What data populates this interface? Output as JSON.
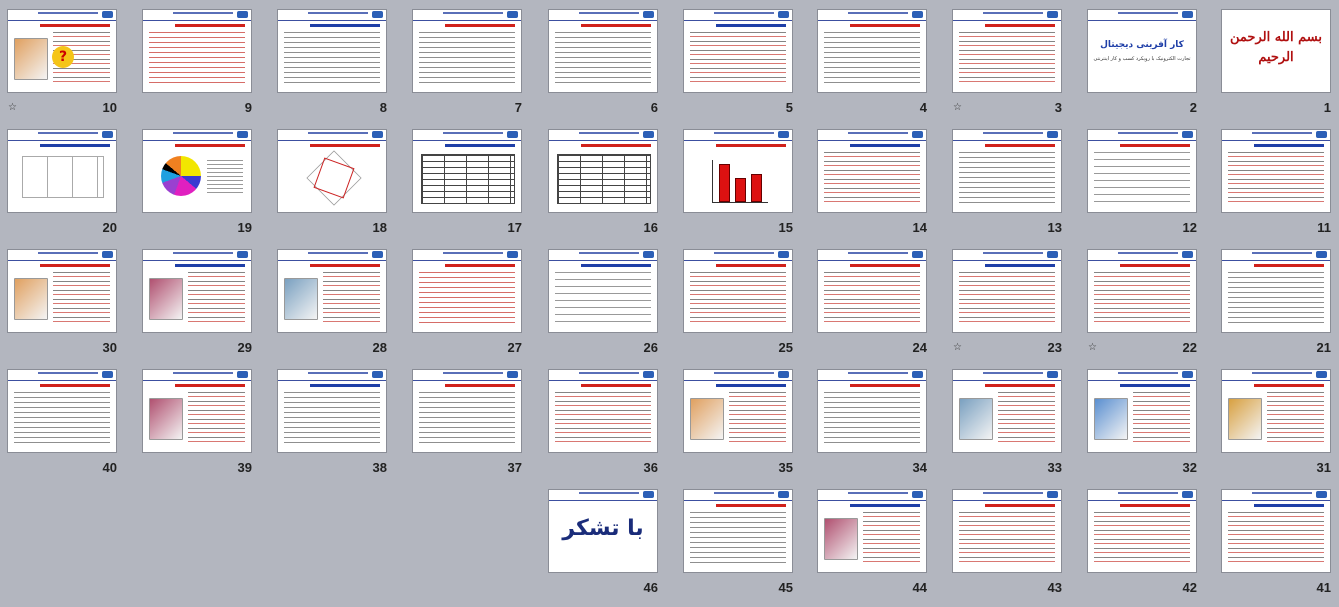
{
  "view": "slide-sorter",
  "slides": [
    {
      "number": "1",
      "variant": "calligraphy",
      "calligraphy": "بسم الله الرحمن الرحیم",
      "star": false
    },
    {
      "number": "2",
      "variant": "cover",
      "cover_title": "کار آفرینی دیجیتال",
      "cover_subtitle": "تجارت الکترونیک با رویکرد کسب و کار اینترنتی",
      "star": false
    },
    {
      "number": "3",
      "variant": "mix",
      "star": true
    },
    {
      "number": "4",
      "variant": "text",
      "star": false
    },
    {
      "number": "5",
      "variant": "mix",
      "star": false
    },
    {
      "number": "6",
      "variant": "text",
      "star": false
    },
    {
      "number": "7",
      "variant": "text",
      "star": false
    },
    {
      "number": "8",
      "variant": "text",
      "star": false
    },
    {
      "number": "9",
      "variant": "red",
      "star": false
    },
    {
      "number": "10",
      "variant": "diagram",
      "star": true
    },
    {
      "number": "11",
      "variant": "mix",
      "star": false
    },
    {
      "number": "12",
      "variant": "sparse",
      "star": false
    },
    {
      "number": "13",
      "variant": "text",
      "star": false
    },
    {
      "number": "14",
      "variant": "mix",
      "star": false
    },
    {
      "number": "15",
      "variant": "barchart",
      "star": false
    },
    {
      "number": "16",
      "variant": "table",
      "star": false
    },
    {
      "number": "17",
      "variant": "table",
      "star": false
    },
    {
      "number": "18",
      "variant": "radar",
      "star": false
    },
    {
      "number": "19",
      "variant": "piechart",
      "star": false
    },
    {
      "number": "20",
      "variant": "boxes",
      "star": false
    },
    {
      "number": "21",
      "variant": "text",
      "star": false
    },
    {
      "number": "22",
      "variant": "mix",
      "star": true
    },
    {
      "number": "23",
      "variant": "mix",
      "star": true
    },
    {
      "number": "24",
      "variant": "mix",
      "star": false
    },
    {
      "number": "25",
      "variant": "mix",
      "star": false
    },
    {
      "number": "26",
      "variant": "sparse",
      "star": false
    },
    {
      "number": "27",
      "variant": "red",
      "star": false
    },
    {
      "number": "28",
      "variant": "image",
      "star": false
    },
    {
      "number": "29",
      "variant": "image",
      "star": false
    },
    {
      "number": "30",
      "variant": "image",
      "star": false
    },
    {
      "number": "31",
      "variant": "image",
      "star": false
    },
    {
      "number": "32",
      "variant": "image",
      "star": false
    },
    {
      "number": "33",
      "variant": "image",
      "star": false
    },
    {
      "number": "34",
      "variant": "text",
      "star": false
    },
    {
      "number": "35",
      "variant": "image",
      "star": false
    },
    {
      "number": "36",
      "variant": "mix",
      "star": false
    },
    {
      "number": "37",
      "variant": "text",
      "star": false
    },
    {
      "number": "38",
      "variant": "text",
      "star": false
    },
    {
      "number": "39",
      "variant": "image",
      "star": false
    },
    {
      "number": "40",
      "variant": "text",
      "star": false
    },
    {
      "number": "41",
      "variant": "mix",
      "star": false
    },
    {
      "number": "42",
      "variant": "mix",
      "star": false
    },
    {
      "number": "43",
      "variant": "mix",
      "star": false
    },
    {
      "number": "44",
      "variant": "image",
      "star": false
    },
    {
      "number": "45",
      "variant": "text",
      "star": false
    },
    {
      "number": "46",
      "variant": "thanks",
      "thanks_text": "با تشکر",
      "star": false
    }
  ]
}
